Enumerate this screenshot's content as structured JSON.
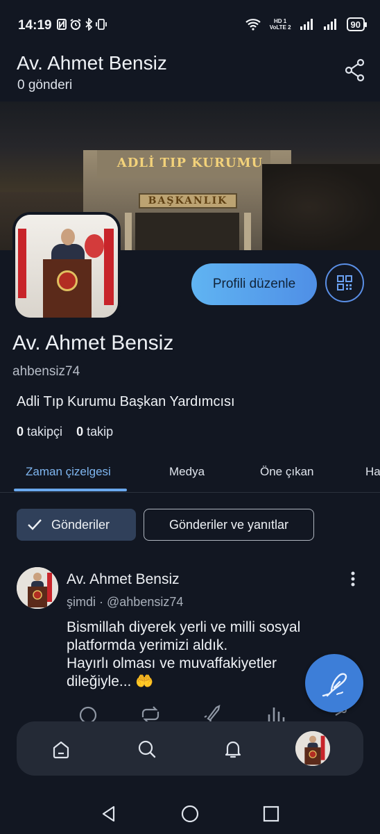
{
  "status_bar": {
    "time": "14:19",
    "battery": "90",
    "network_top": "HD 1",
    "network_bottom": "VoLTE 2"
  },
  "header": {
    "title": "Av. Ahmet Bensiz",
    "subtitle": "0 gönderi"
  },
  "banner": {
    "sign_top": "ADLİ TIP KURUMU",
    "sign_bottom": "BAŞKANLIK"
  },
  "profile": {
    "edit_label": "Profili düzenle",
    "display_name": "Av. Ahmet Bensiz",
    "handle": "ahbensiz74",
    "bio": "Adli Tıp Kurumu Başkan Yardımcısı",
    "followers_count": "0",
    "followers_label": "takipçi",
    "following_count": "0",
    "following_label": "takip"
  },
  "tabs": [
    {
      "label": "Zaman çizelgesi",
      "active": true
    },
    {
      "label": "Medya",
      "active": false
    },
    {
      "label": "Öne çıkan",
      "active": false
    },
    {
      "label": "Ha",
      "active": false
    }
  ],
  "filters": {
    "posts": "Gönderiler",
    "posts_and_replies": "Gönderiler ve yanıtlar"
  },
  "post": {
    "author": "Av. Ahmet Bensiz",
    "time": "şimdi",
    "handle": "@ahbensiz74",
    "text": "Bismillah diyerek yerli ve milli sosyal\nplatformda yerimizi aldık.\nHayırlı olması ve muvaffakiyetler\ndileğiyle... 🤲"
  },
  "colors": {
    "accent": "#4f8fe6",
    "background": "#121722",
    "nav_bg": "#242a36"
  },
  "icons": [
    "share-icon",
    "qr-code-icon",
    "check-icon",
    "more-vertical-icon",
    "reply-icon",
    "repost-icon",
    "boost-icon",
    "stats-icon",
    "share-icon",
    "compose-icon",
    "home-icon",
    "search-icon",
    "bell-icon",
    "back-icon",
    "home-circle-icon",
    "recents-icon"
  ]
}
